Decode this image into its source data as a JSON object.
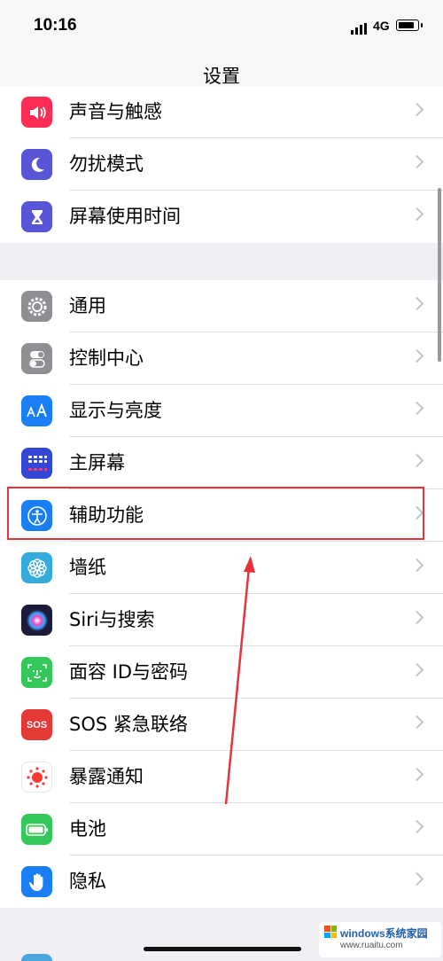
{
  "status": {
    "time": "10:16",
    "network": "4G"
  },
  "nav": {
    "title": "设置"
  },
  "groups": [
    {
      "items": [
        {
          "label": "声音与触感",
          "icon": "speaker-icon",
          "color": "#ff2d55"
        },
        {
          "label": "勿扰模式",
          "icon": "moon-icon",
          "color": "#5856d6"
        },
        {
          "label": "屏幕使用时间",
          "icon": "hourglass-icon",
          "color": "#5856d6"
        }
      ]
    },
    {
      "items": [
        {
          "label": "通用",
          "icon": "gear-icon",
          "color": "#8e8e93"
        },
        {
          "label": "控制中心",
          "icon": "toggles-icon",
          "color": "#8e8e93"
        },
        {
          "label": "显示与亮度",
          "icon": "text-size-icon",
          "color": "#1a7ef5"
        },
        {
          "label": "主屏幕",
          "icon": "app-grid-icon",
          "color": "#3247d6"
        },
        {
          "label": "辅助功能",
          "icon": "accessibility-icon",
          "color": "#1a7ef5"
        },
        {
          "label": "墙纸",
          "icon": "flower-icon",
          "color": "#35aadc"
        },
        {
          "label": "Siri与搜索",
          "icon": "siri-icon",
          "color": "#1c1c3a"
        },
        {
          "label": "面容 ID与密码",
          "icon": "face-id-icon",
          "color": "#34c759"
        },
        {
          "label": "SOS 紧急联络",
          "icon": "sos-icon",
          "color": "#e53935",
          "icon_text": "SOS"
        },
        {
          "label": "暴露通知",
          "icon": "exposure-icon",
          "color": "#ffffff"
        },
        {
          "label": "电池",
          "icon": "battery-icon",
          "color": "#34c759"
        },
        {
          "label": "隐私",
          "icon": "hand-icon",
          "color": "#1a7ef5"
        }
      ]
    }
  ],
  "highlight": {
    "item": "辅助功能",
    "color": "#e8333c"
  },
  "watermark": {
    "line1": "windows系统家园",
    "line2": "www.ruaitu.com"
  }
}
